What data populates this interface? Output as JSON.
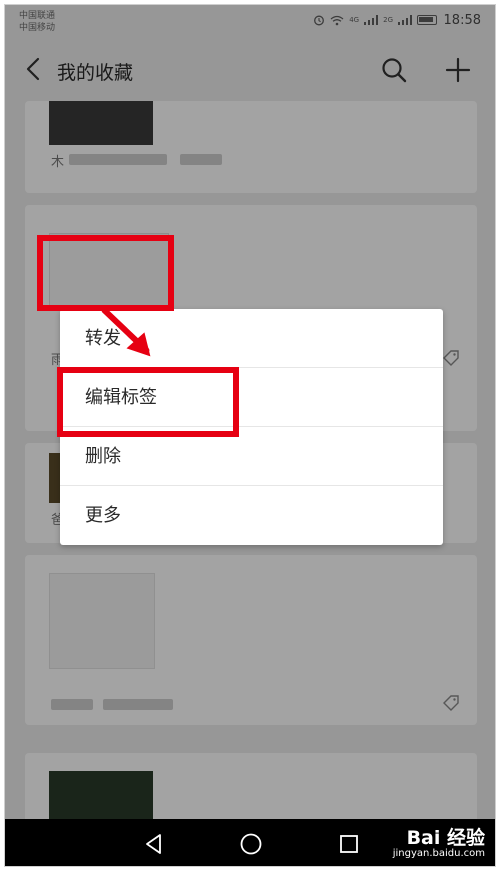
{
  "status_bar": {
    "carrier_1": "中国联通",
    "carrier_2": "中国移动",
    "net_1": "4G",
    "net_2": "2G",
    "time": "18:58"
  },
  "app_bar": {
    "title": "我的收藏",
    "back_icon": "back-chevron-icon",
    "search_icon": "search-icon",
    "add_icon": "plus-icon"
  },
  "list": {
    "card_1_partial_text": "木",
    "card_2_partial_text": "雨",
    "card_3_partial_text": "爸"
  },
  "context_menu": {
    "items": [
      {
        "label": "转发"
      },
      {
        "label": "编辑标签"
      },
      {
        "label": "删除"
      },
      {
        "label": "更多"
      }
    ]
  },
  "nav_bar": {
    "back_icon": "triangle-back-icon",
    "home_icon": "circle-home-icon",
    "recents_icon": "square-recents-icon"
  },
  "watermark": {
    "brand": "Bai 经验",
    "url": "jingyan.baidu.com"
  },
  "colors": {
    "annotation_red": "#e60012",
    "background": "#ededed",
    "navbar": "#000000"
  }
}
